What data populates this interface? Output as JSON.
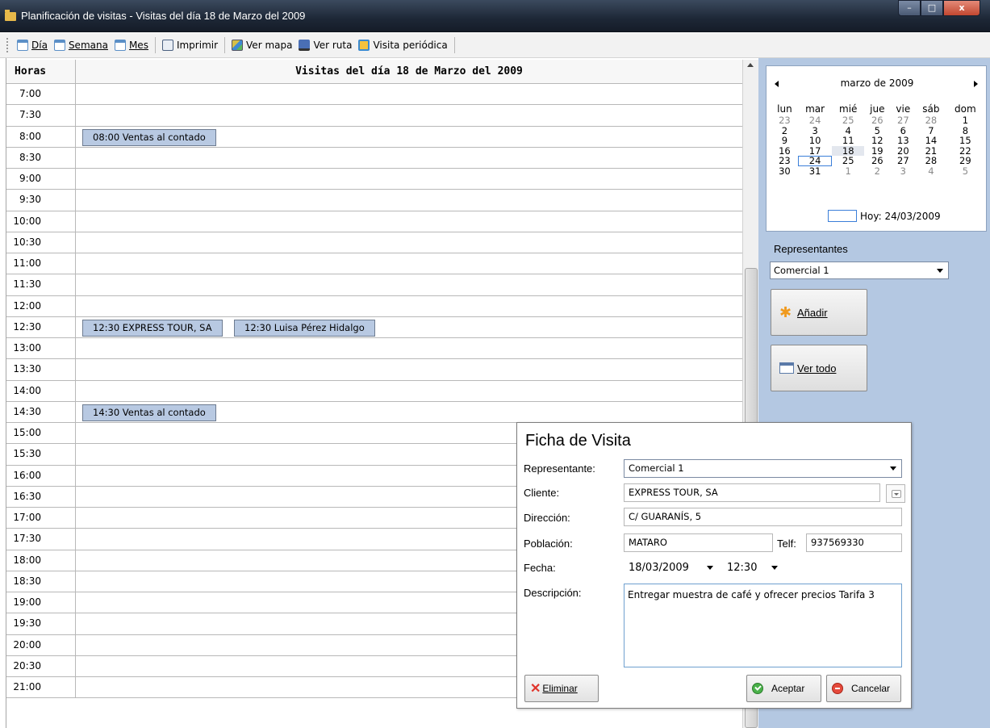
{
  "window": {
    "title": "Planificación de visitas - Visitas del día 18 de Marzo del 2009",
    "min": "–",
    "max": "□",
    "close": "x"
  },
  "toolbar": {
    "dia": "Día",
    "semana": "Semana",
    "mes": "Mes",
    "imprimir": "Imprimir",
    "ver_mapa": "Ver mapa",
    "ver_ruta": "Ver ruta",
    "visita_periodica": "Visita periódica"
  },
  "grid": {
    "col_hours": "Horas",
    "col_title": "Visitas del día 18 de Marzo del 2009",
    "times": [
      "7:00",
      "7:30",
      "8:00",
      "8:30",
      "9:00",
      "9:30",
      "10:00",
      "10:30",
      "11:00",
      "11:30",
      "12:00",
      "12:30",
      "13:00",
      "13:30",
      "14:00",
      "14:30",
      "15:00",
      "15:30",
      "16:00",
      "16:30",
      "17:00",
      "17:30",
      "18:00",
      "18:30",
      "19:00",
      "19:30",
      "20:00",
      "20:30",
      "21:00"
    ],
    "appointments": [
      {
        "row": 2,
        "label": "08:00 Ventas al contado"
      },
      {
        "row": 11,
        "label": "12:30 EXPRESS TOUR, SA"
      },
      {
        "row": 11,
        "label": "12:30 Luisa Pérez Hidalgo"
      },
      {
        "row": 15,
        "label": "14:30 Ventas al contado"
      }
    ]
  },
  "calendar": {
    "month": "marzo de 2009",
    "weekdays": [
      "lun",
      "mar",
      "mié",
      "jue",
      "vie",
      "sáb",
      "dom"
    ],
    "weeks": [
      [
        "23",
        "24",
        "25",
        "26",
        "27",
        "28",
        "1"
      ],
      [
        "2",
        "3",
        "4",
        "5",
        "6",
        "7",
        "8"
      ],
      [
        "9",
        "10",
        "11",
        "12",
        "13",
        "14",
        "15"
      ],
      [
        "16",
        "17",
        "18",
        "19",
        "20",
        "21",
        "22"
      ],
      [
        "23",
        "24",
        "25",
        "26",
        "27",
        "28",
        "29"
      ],
      [
        "30",
        "31",
        "1",
        "2",
        "3",
        "4",
        "5"
      ]
    ],
    "today": "Hoy: 24/03/2009"
  },
  "panel": {
    "rep_label": "Representantes",
    "rep_value": "Comercial 1",
    "add": "Añadir",
    "view_all": "Ver todo"
  },
  "dialog": {
    "title": "Ficha de Visita",
    "rep_label": "Representante:",
    "rep_value": "Comercial 1",
    "client_label": "Cliente:",
    "client_value": "EXPRESS TOUR, SA",
    "address_label": "Dirección:",
    "address_value": "C/ GUARANÍS, 5",
    "city_label": "Población:",
    "city_value": "MATARO",
    "phone_label": "Telf:",
    "phone_value": "937569330",
    "date_label": "Fecha:",
    "date_value": "18/03/2009",
    "time_value": "12:30",
    "desc_label": "Descripción:",
    "desc_value": "Entregar muestra de café y ofrecer precios Tarifa 3",
    "delete": "Eliminar",
    "accept": "Aceptar",
    "cancel": "Cancelar"
  }
}
